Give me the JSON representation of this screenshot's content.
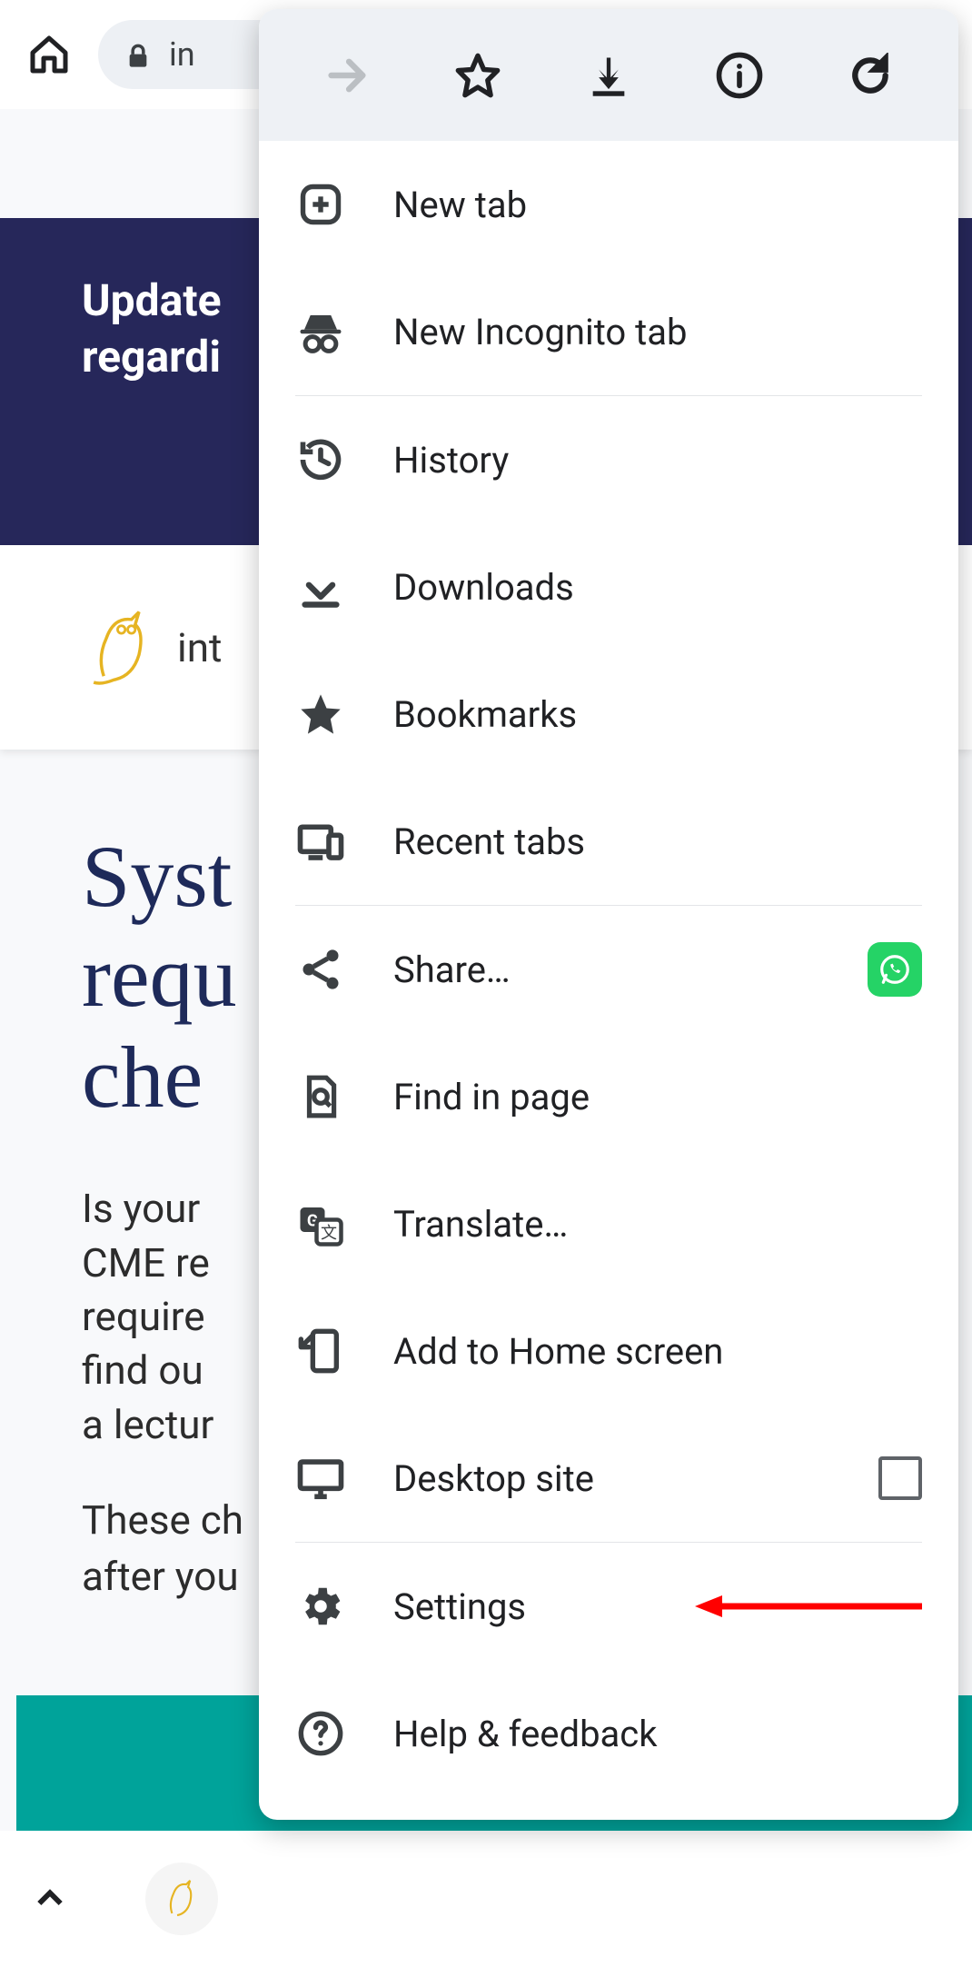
{
  "browser": {
    "url_fragment": "in"
  },
  "page_content": {
    "banner_line1": "Update",
    "banner_line2": "regardi",
    "brand_text": "int",
    "heading": "Syst requ che",
    "body1": "Is your CME re require find ou a lectur",
    "body2": "These ch after you"
  },
  "menu": {
    "items": [
      {
        "label": "New tab"
      },
      {
        "label": "New Incognito tab"
      },
      {
        "label": "History"
      },
      {
        "label": "Downloads"
      },
      {
        "label": "Bookmarks"
      },
      {
        "label": "Recent tabs"
      },
      {
        "label": "Share…"
      },
      {
        "label": "Find in page"
      },
      {
        "label": "Translate…"
      },
      {
        "label": "Add to Home screen"
      },
      {
        "label": "Desktop site"
      },
      {
        "label": "Settings"
      },
      {
        "label": "Help & feedback"
      }
    ],
    "desktop_site_checked": false
  },
  "annotation": {
    "points_to": "Settings"
  }
}
